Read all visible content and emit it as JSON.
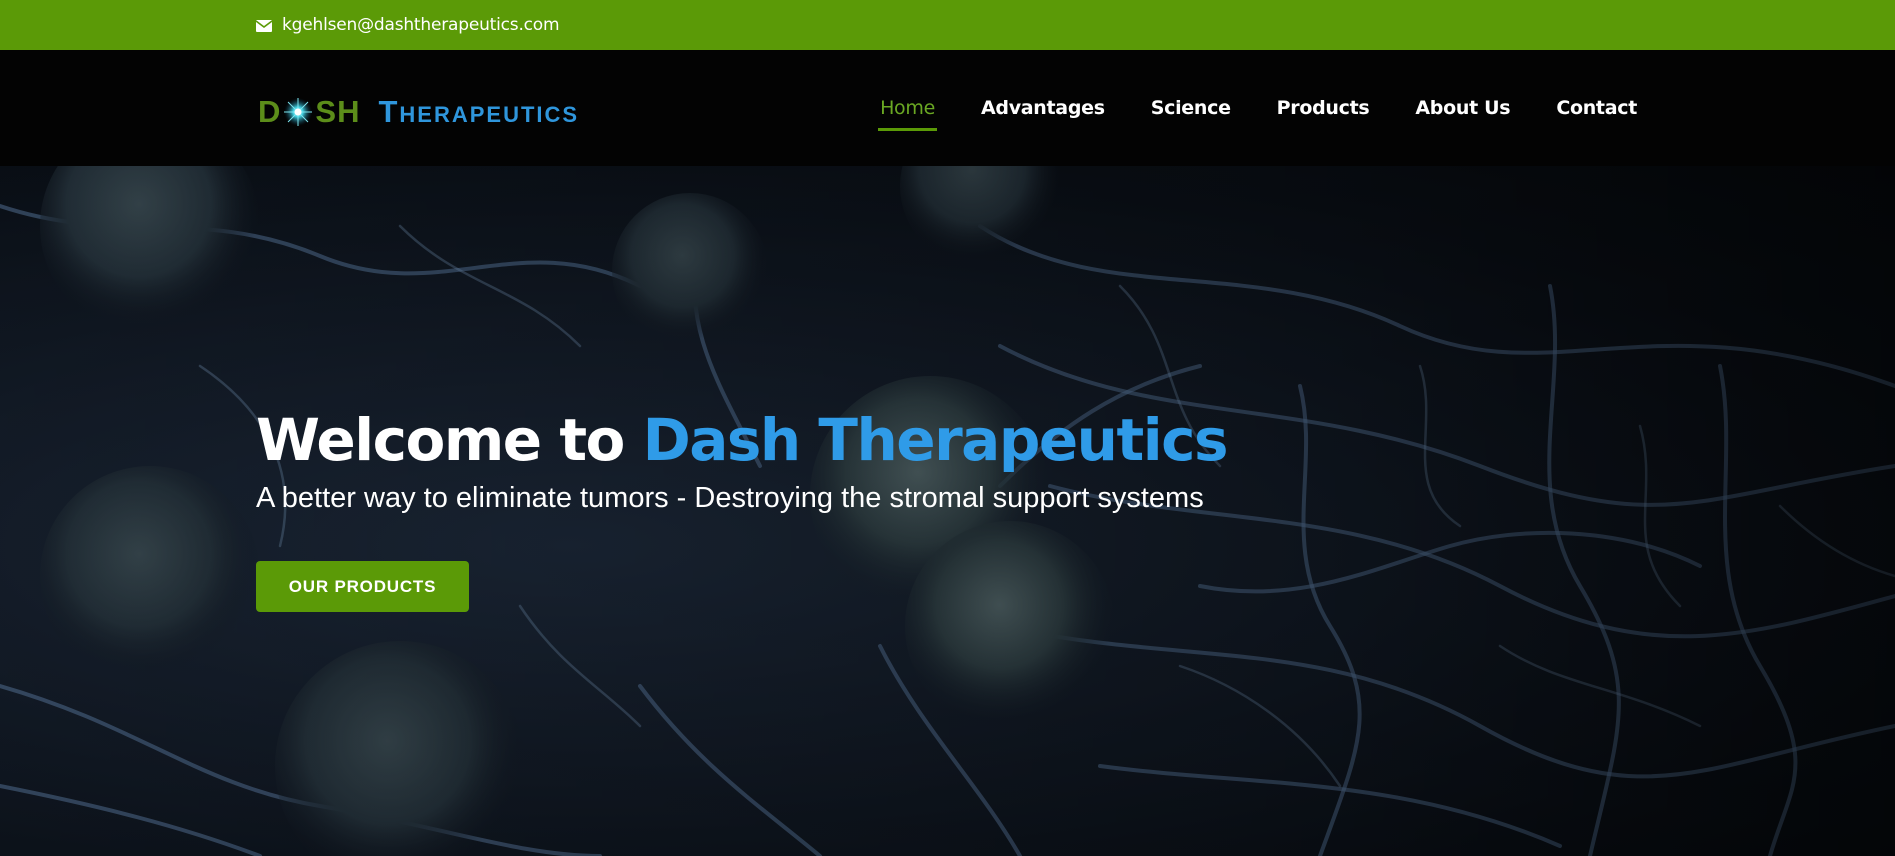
{
  "topbar": {
    "email": "kgehlsen@dashtherapeutics.com",
    "email_icon": "mail-icon",
    "background": "#5b9a07"
  },
  "logo": {
    "part1_left": "D",
    "part1_right": "SH",
    "part2": "Therapeutics",
    "colors": {
      "dash": "#5c8d1a",
      "therapeutics": "#2f96dc"
    }
  },
  "nav": {
    "items": [
      {
        "label": "Home",
        "active": true
      },
      {
        "label": "Advantages",
        "active": false
      },
      {
        "label": "Science",
        "active": false
      },
      {
        "label": "Products",
        "active": false
      },
      {
        "label": "About Us",
        "active": false
      },
      {
        "label": "Contact",
        "active": false
      }
    ],
    "active_color": "#6aa823"
  },
  "hero": {
    "headline_prefix": "Welcome to ",
    "headline_accent": "Dash Therapeutics",
    "subheadline": "A better way to eliminate tumors - Destroying the stromal support systems",
    "cta_label": "OUR PRODUCTS",
    "accent_color": "#2f9be8",
    "cta_color": "#5b9a07"
  }
}
